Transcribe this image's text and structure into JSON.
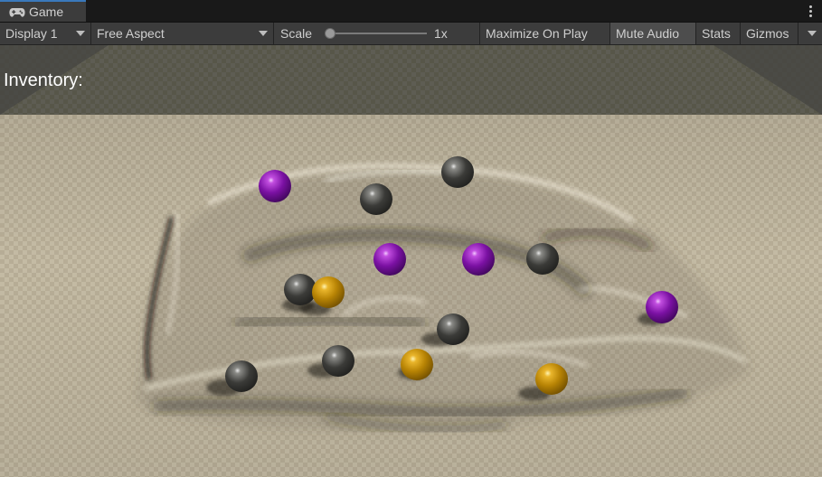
{
  "tab": {
    "label": "Game",
    "icon": "gamepad-icon"
  },
  "toolbar": {
    "display": "Display 1",
    "aspect": "Free Aspect",
    "scale_label": "Scale",
    "scale_value": "1x",
    "maximize": "Maximize On Play",
    "mute": "Mute Audio",
    "stats": "Stats",
    "gizmos": "Gizmos"
  },
  "hud": {
    "inventory": "Inventory:"
  },
  "colors": {
    "purple": "#7b11a3",
    "dark": "#3b3b38",
    "gold": "#b88405",
    "tab_accent": "#3a79bb"
  }
}
